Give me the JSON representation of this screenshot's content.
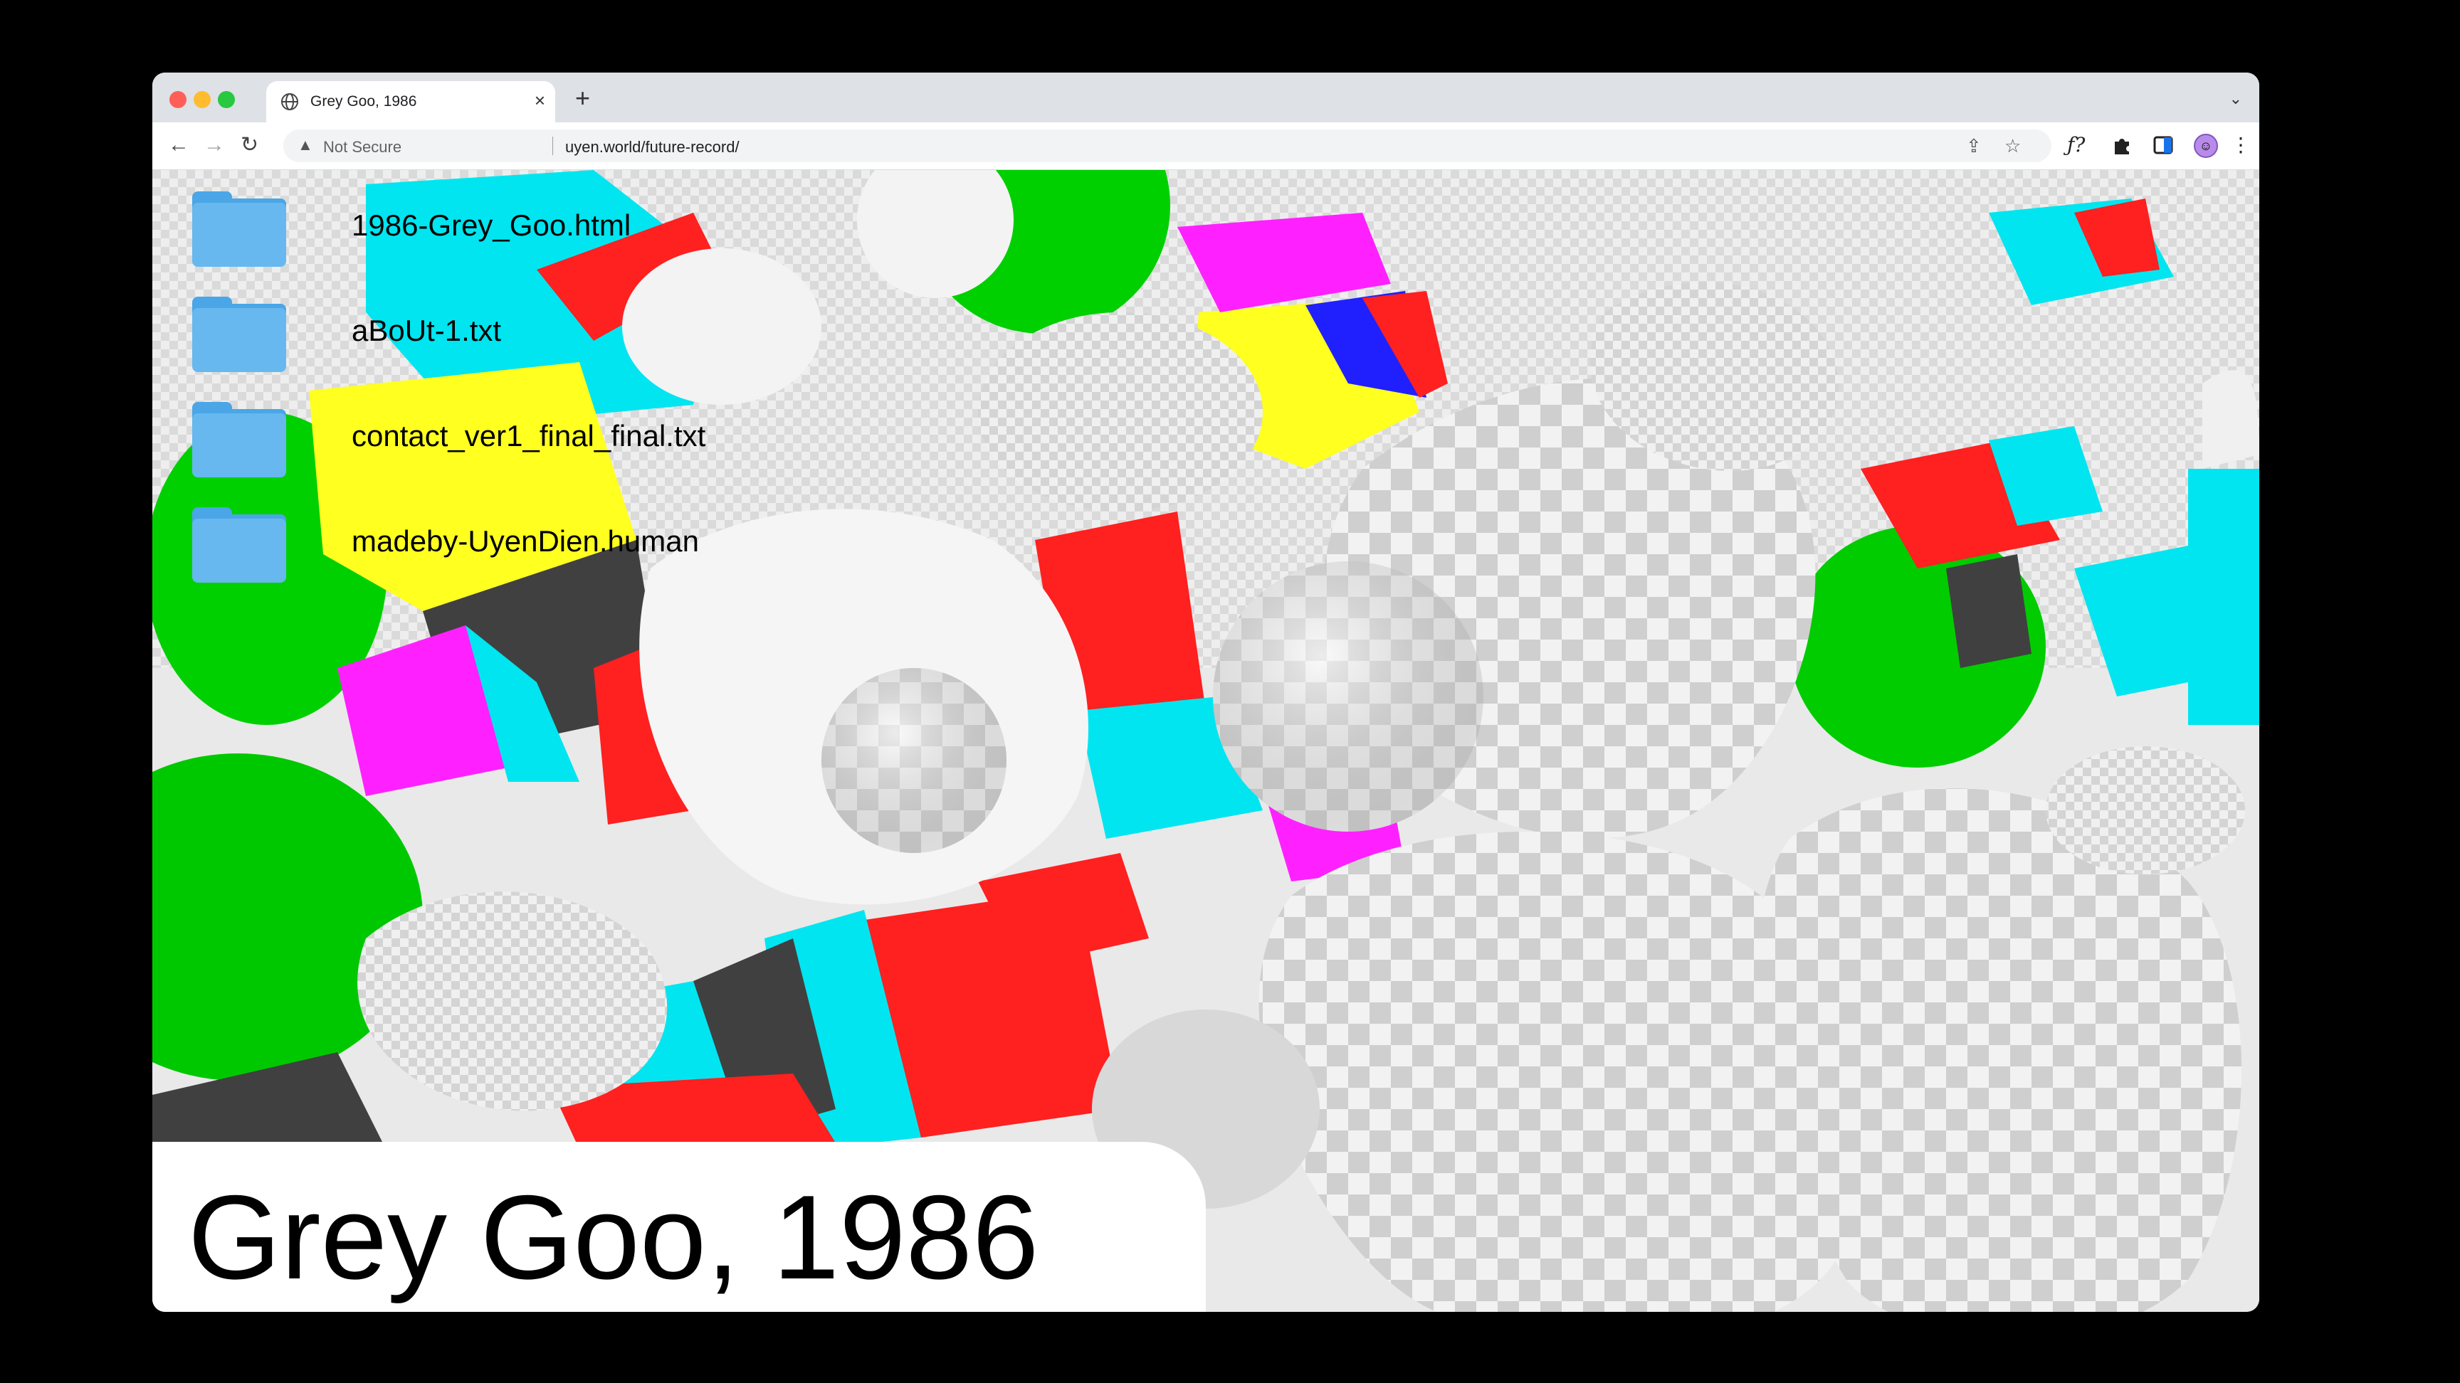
{
  "browser": {
    "tab_title": "Grey Goo, 1986",
    "tab_close": "×",
    "new_tab": "+",
    "tab_menu": "⌄",
    "security_label": "Not Secure",
    "url": "uyen.world/future-record/",
    "icons": [
      "back-icon",
      "forward-icon",
      "reload-icon",
      "warning-icon",
      "share-icon",
      "star-icon",
      "formula-extension-icon",
      "puzzle-extensions-icon",
      "sidebar-icon",
      "profile-avatar",
      "menu-icon"
    ],
    "formula_extension_label": "ƒ?"
  },
  "desktop": {
    "items": [
      {
        "label": "1986-Grey_Goo.html"
      },
      {
        "label": "aBoUt-1.txt"
      },
      {
        "label": "contact_ver1_final_final.txt"
      },
      {
        "label": "madeby-UyenDien.human"
      }
    ]
  },
  "title_card": {
    "text": "Grey Goo, 1986"
  },
  "colors": {
    "background": "#000000",
    "tabstrip": "#dee1e6",
    "folder": "#67b8ef",
    "scene_palette": [
      "#f0f0f0",
      "#00d000",
      "#00e5f0",
      "#ff2020",
      "#ffff20",
      "#ff20ff",
      "#2020ff",
      "#404040"
    ]
  }
}
